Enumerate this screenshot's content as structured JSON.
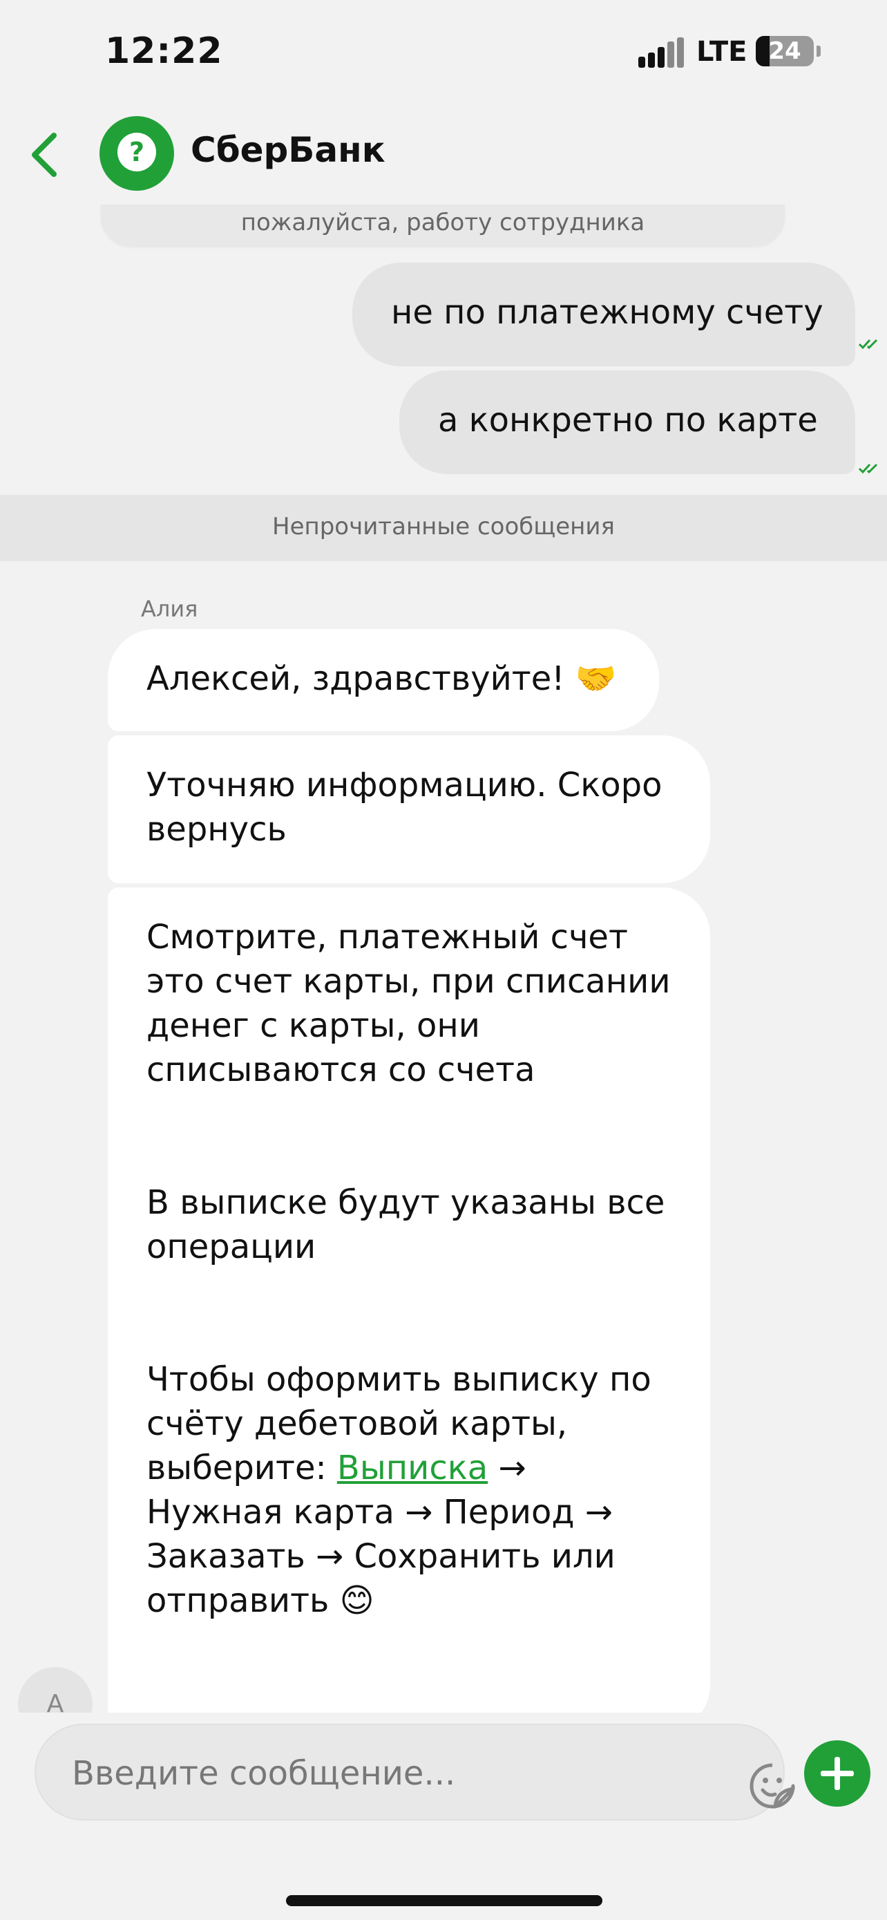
{
  "status_bar": {
    "time": "12:22",
    "network": "LTE",
    "battery": "24",
    "battery_level": 0.24
  },
  "header": {
    "title": "СберБанк",
    "avatar_icon": "question-mark-icon",
    "avatar_glyph": "?"
  },
  "system_message": {
    "text": "пожалуйста, работу сотрудника"
  },
  "outgoing": [
    {
      "text": "не по платежному счету"
    },
    {
      "text": "а конкретно по карте"
    }
  ],
  "divider": {
    "text": "Непрочитанные сообщения"
  },
  "incoming": {
    "sender": "Алия",
    "sender_initial": "А",
    "messages": [
      {
        "text": "Алексей, здравствуйте! 🤝"
      },
      {
        "text": "Уточняю информацию. Скоро вернусь"
      }
    ],
    "long_message": {
      "p1": "Смотрите, платежный счет это счет карты, при списании денег с карты, они списываются со счета",
      "p2": "В выписке будут указаны все операции",
      "p3": "Чтобы оформить выписку по счёту дебетовой карты, выберите:",
      "link": "Выписка",
      "steps": " → Нужная карта → Период → Заказать → Сохранить или отправить 😊"
    }
  },
  "composer": {
    "placeholder": "Введите сообщение..."
  },
  "colors": {
    "brand": "#21a038",
    "outgoing_bubble": "#e4e4e4",
    "incoming_bubble": "#ffffff"
  }
}
